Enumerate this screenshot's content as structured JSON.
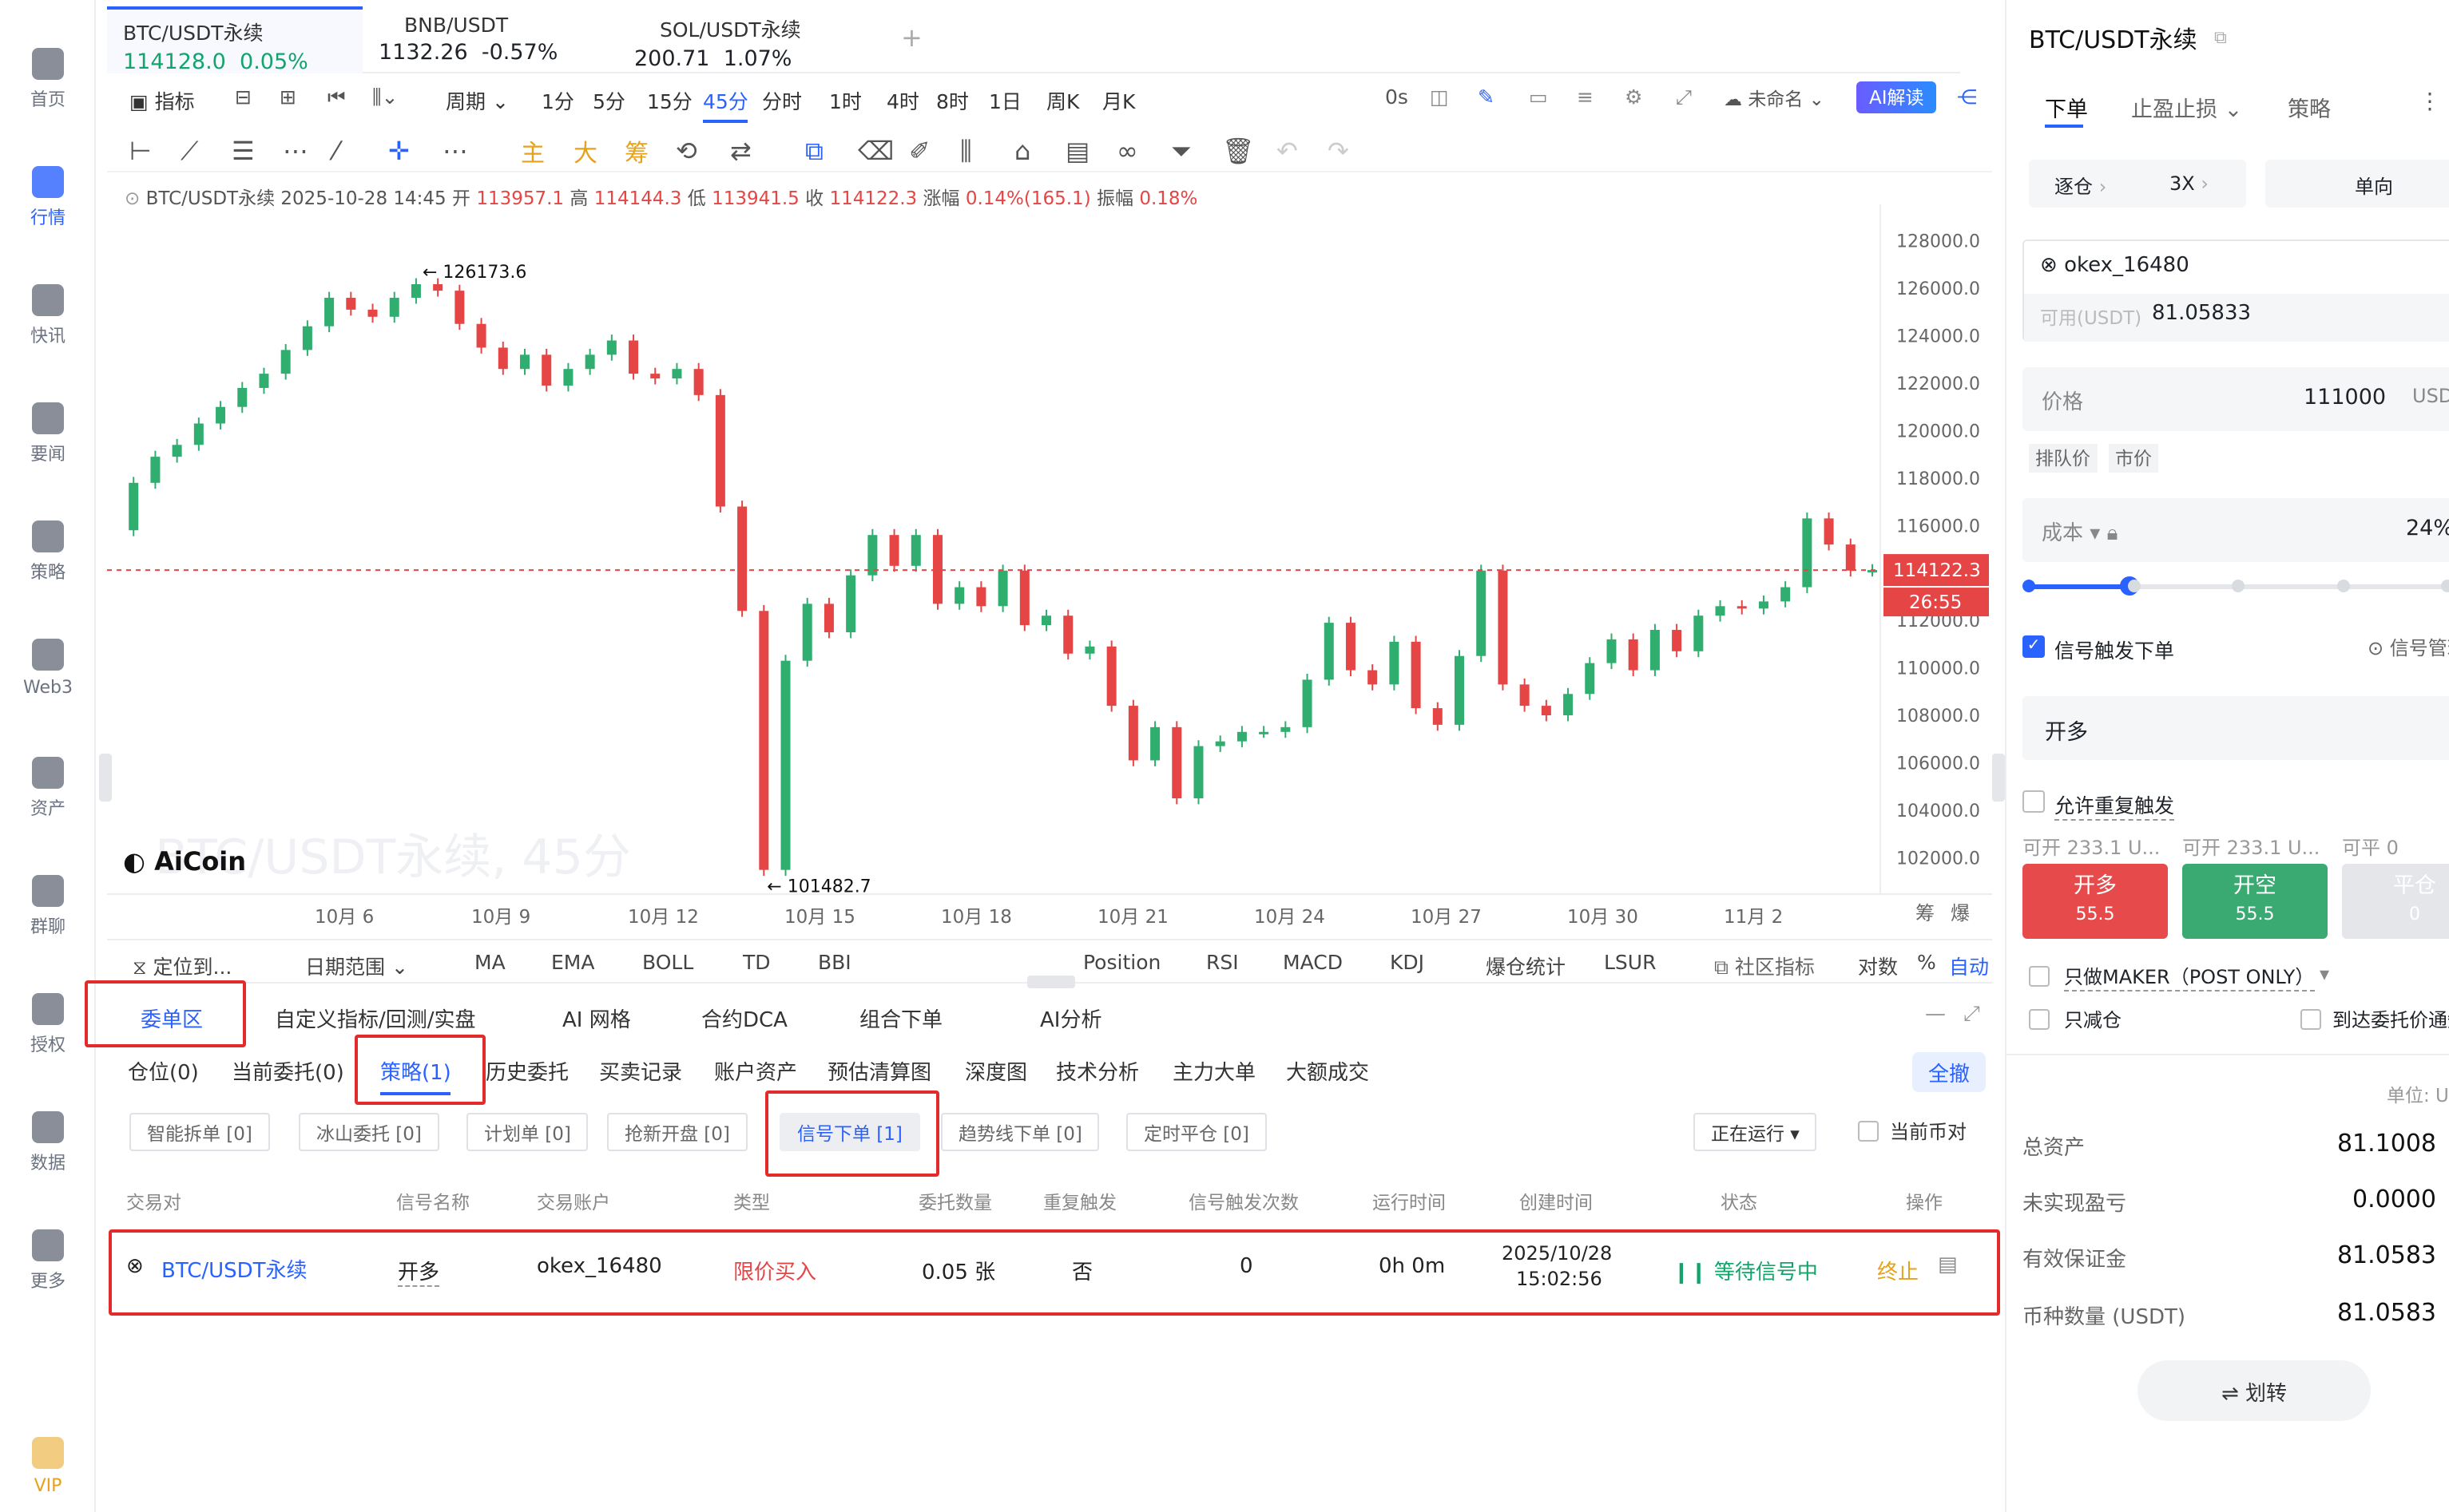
{
  "nav": {
    "items": [
      {
        "label": "首页",
        "icon": "home-icon"
      },
      {
        "label": "行情",
        "icon": "market-chart-icon"
      },
      {
        "label": "快讯",
        "icon": "flash-news-icon"
      },
      {
        "label": "要闻",
        "icon": "news-icon"
      },
      {
        "label": "策略",
        "icon": "strategy-robot-icon"
      },
      {
        "label": "Web3",
        "icon": "web3-icon"
      },
      {
        "label": "资产",
        "icon": "wallet-icon"
      },
      {
        "label": "群聊",
        "icon": "chat-icon"
      },
      {
        "label": "授权",
        "icon": "authorize-icon"
      },
      {
        "label": "数据",
        "icon": "data-icon"
      },
      {
        "label": "更多",
        "icon": "more-grid-icon"
      },
      {
        "label": "VIP",
        "icon": "vip-diamond-icon"
      }
    ]
  },
  "symbols": [
    {
      "name": "BTC/USDT永续",
      "price": "114128.0",
      "change": "0.05%",
      "dir": "up"
    },
    {
      "name": "BNB/USDT",
      "price": "1132.26",
      "change": "-0.57%",
      "dir": "dn"
    },
    {
      "name": "SOL/USDT永续",
      "price": "200.71",
      "change": "1.07%",
      "dir": "dn"
    }
  ],
  "toolbar": {
    "indicator": "指标",
    "period": "周期",
    "intervals": [
      "1分",
      "5分",
      "15分",
      "45分",
      "分时",
      "1时",
      "4时",
      "8时",
      "1日",
      "周K",
      "月K"
    ],
    "active_interval": "45分",
    "countdown": "0s",
    "layout_name": "未命名",
    "ai_button": "AI解读"
  },
  "drawing_tools": {
    "main": "主",
    "big": "大",
    "chip": "筹"
  },
  "ohlc": {
    "symbol": "BTC/USDT永续",
    "time": "2025-10-28 14:45",
    "open_label": "开",
    "open": "113957.1",
    "high_label": "高",
    "high": "114144.3",
    "low_label": "低",
    "low": "113941.5",
    "close_label": "收",
    "close": "114122.3",
    "change_label": "涨幅",
    "change": "0.14%(165.1)",
    "amp_label": "振幅",
    "amp": "0.18%"
  },
  "chart_data": {
    "type": "line",
    "title": "",
    "watermark": "BTC/USDT永续, 45分",
    "x_ticks": [
      "10月 6",
      "10月 9",
      "10月 12",
      "10月 15",
      "10月 18",
      "10月 21",
      "10月 24",
      "10月 27",
      "10月 30",
      "11月 2"
    ],
    "y_ticks": [
      "128000.0",
      "126000.0",
      "124000.0",
      "122000.0",
      "120000.0",
      "118000.0",
      "116000.0",
      "114000.0",
      "112000.0",
      "110000.0",
      "108000.0",
      "106000.0",
      "104000.0",
      "102000.0"
    ],
    "ylim": [
      101000,
      129000
    ],
    "series": [
      {
        "values": [
          115800,
          117800,
          118900,
          119400,
          120300,
          121000,
          121800,
          122400,
          123400,
          124400,
          125600,
          125100,
          124800,
          125600,
          126173.6,
          125900,
          124500,
          123500,
          122600,
          123200,
          121900,
          122600,
          123200,
          123800,
          122400,
          122200,
          122600,
          121500,
          116800,
          112400,
          101482.7,
          110300,
          112700,
          111500,
          113900,
          115600,
          114300,
          115600,
          112700,
          113400,
          112600,
          114100,
          111800,
          112200,
          110600,
          110900,
          108400,
          106100,
          107500,
          104500,
          106700,
          106900,
          107300,
          107300,
          107500,
          109500,
          111900,
          109900,
          109300,
          111100,
          108300,
          107600,
          110500,
          114100,
          109300,
          108400,
          108000,
          108900,
          110200,
          111200,
          109900,
          111600,
          110700,
          112200,
          112600,
          112500,
          112800,
          113400,
          116300,
          115200,
          114100,
          114122.3
        ]
      }
    ],
    "annotations": {
      "high": "← 126173.6",
      "low": "← 101482.7"
    },
    "last_price": "114122.3",
    "timer": "26:55",
    "right_labels": [
      "筹",
      "爆"
    ],
    "grid": false
  },
  "brand": "AiCoin",
  "indbar": {
    "locate": "定位到...",
    "range": "日期范围",
    "items": [
      "MA",
      "EMA",
      "BOLL",
      "TD",
      "BBI",
      "Position",
      "RSI",
      "MACD",
      "KDJ",
      "爆仓统计",
      "LSUR"
    ],
    "community": "社区指标",
    "log": "对数",
    "pct": "%",
    "auto": "自动"
  },
  "panel_tabs": [
    "委单区",
    "自定义指标/回测/实盘",
    "AI 网格",
    "合约DCA",
    "组合下单",
    "AI分析"
  ],
  "sub_tabs": [
    "仓位(0)",
    "当前委托(0)",
    "策略(1)",
    "历史委托",
    "买卖记录",
    "账户资产",
    "预估清算图",
    "深度图",
    "技术分析",
    "主力大单",
    "大额成交"
  ],
  "cancel_all": "全撤",
  "filters": [
    "智能拆单 [0]",
    "冰山委托 [0]",
    "计划单 [0]",
    "抢新开盘 [0]",
    "信号下单 [1]",
    "趋势线下单 [0]",
    "定时平仓 [0]"
  ],
  "running": "正在运行",
  "current_pair": "当前币对",
  "table": {
    "headers": [
      "交易对",
      "信号名称",
      "交易账户",
      "类型",
      "委托数量",
      "重复触发",
      "信号触发次数",
      "运行时间",
      "创建时间",
      "状态",
      "操作"
    ],
    "row": {
      "pair": "BTC/USDT永续",
      "signal": "开多",
      "account": "okex_16480",
      "type": "限价买入",
      "qty": "0.05 张",
      "repeat": "否",
      "count": "0",
      "runtime": "0h 0m",
      "date": "2025/10/28",
      "time": "15:02:56",
      "status": "等待信号中",
      "stop": "终止"
    }
  },
  "right": {
    "title": "BTC/USDT永续",
    "tabs": [
      "下单",
      "止盈止损",
      "策略"
    ],
    "margin": "逐仓",
    "leverage": "3X",
    "mode": "单向",
    "account": "okex_16480",
    "avail_label": "可用(USDT)",
    "avail": "81.05833",
    "price_label": "价格",
    "price": "111000",
    "unit": "USDT",
    "queue": "排队价",
    "market": "市价",
    "cost": "成本",
    "pct": "24%",
    "slider_fraction": 0.24,
    "signal_order": "信号触发下单",
    "signal_mgr": "信号管理",
    "direction": "开多",
    "allow_repeat": "允许重复触发",
    "can_open1": "可开 233.1 U...",
    "can_open2": "可开 233.1 U...",
    "can_close": "可平 0",
    "btn_long": "开多",
    "btn_long_v": "55.5",
    "btn_short": "开空",
    "btn_short_v": "55.5",
    "btn_close": "平仓",
    "btn_close_v": "0",
    "maker": "只做MAKER（POST ONLY）",
    "reduce": "只减仓",
    "notify": "到达委托价通知",
    "unit_label": "单位: USDT",
    "assets": [
      {
        "k": "总资产",
        "v": "81.1008"
      },
      {
        "k": "未实现盈亏",
        "v": "0.0000"
      },
      {
        "k": "有效保证金",
        "v": "81.0583"
      },
      {
        "k": "币种数量 (USDT)",
        "v": "81.0583"
      }
    ],
    "transfer": "划转"
  }
}
